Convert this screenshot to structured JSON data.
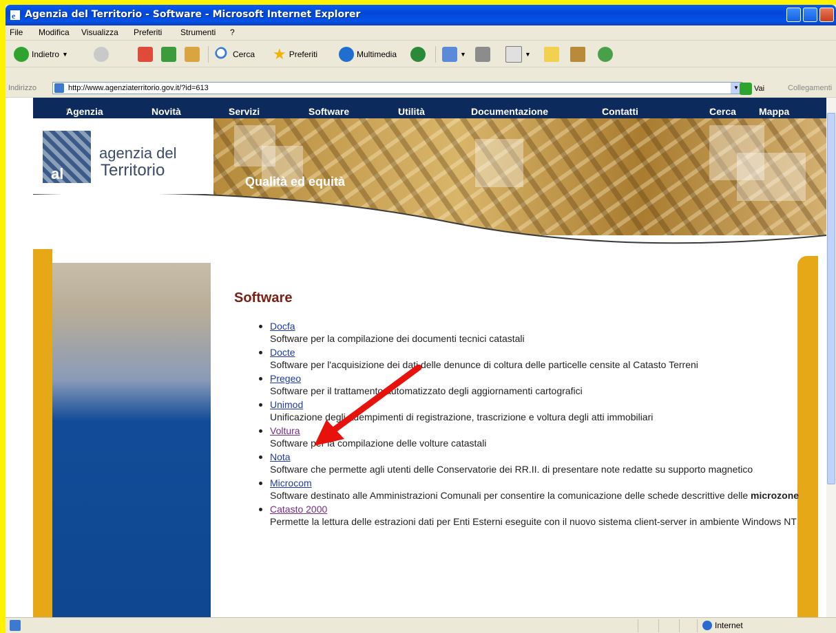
{
  "window": {
    "title": "Agenzia del Territorio - Software - Microsoft Internet Explorer"
  },
  "menu": [
    "File",
    "Modifica",
    "Visualizza",
    "Preferiti",
    "Strumenti",
    "?"
  ],
  "toolbar": {
    "back": "Indietro",
    "search": "Cerca",
    "favorites": "Preferiti",
    "media": "Multimedia"
  },
  "address": {
    "label": "Indirizzo",
    "url": "http://www.agenziaterritorio.gov.it/?id=613",
    "go": "Vai",
    "links": "Collegamenti"
  },
  "site": {
    "nav": [
      "Agenzia",
      "Novità",
      "Servizi",
      "Software",
      "Utilità",
      "Documentazione",
      "Contatti"
    ],
    "nav_right": [
      "Cerca",
      "Mappa"
    ],
    "logo_line1": "agenzia del",
    "logo_line2": "Territorio",
    "logo_mark": "al",
    "tagline": "Qualità ed equità",
    "heading": "Software",
    "items": [
      {
        "link": "Docfa",
        "desc": "Software per la compilazione dei documenti tecnici catastali"
      },
      {
        "link": "Docte",
        "desc": "Software per l'acquisizione dei dati delle denunce di coltura delle particelle censite al Catasto Terreni"
      },
      {
        "link": "Pregeo",
        "desc": "Software per il trattamento automatizzato degli aggiornamenti cartografici"
      },
      {
        "link": "Unimod",
        "desc": "Unificazione degli adempimenti di registrazione, trascrizione e voltura degli atti immobiliari"
      },
      {
        "link": "Voltura",
        "desc": "Software per la compilazione delle volture catastali"
      },
      {
        "link": "Nota",
        "desc": "Software che permette agli utenti delle Conservatorie dei RR.II. di presentare note redatte su supporto magnetico"
      },
      {
        "link": "Microcom",
        "desc": "Software destinato alle Amministrazioni Comunali per consentire la comunicazione delle schede descrittive delle",
        "bold": "microzone"
      },
      {
        "link": "Catasto 2000",
        "desc": "Permette la lettura delle estrazioni dati per Enti Esterni eseguite con il nuovo sistema client-server in ambiente Windows NT"
      }
    ]
  },
  "status": {
    "zone": "Internet"
  },
  "colors": {
    "background": "#fdf200",
    "nav": "#0c2a5c",
    "accent": "#e6a817",
    "heading": "#7a1e14",
    "link": "#1e3aa6",
    "visited": "#7a2a8a",
    "arrow": "#e8120c"
  }
}
